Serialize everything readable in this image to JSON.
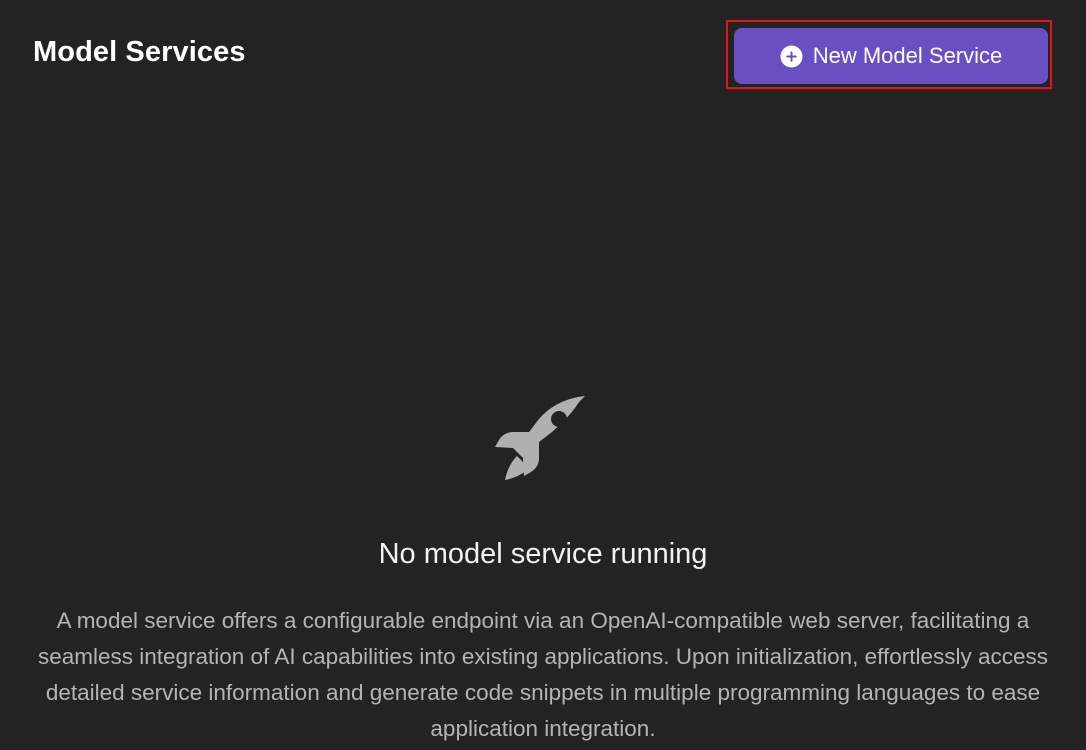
{
  "header": {
    "title": "Model Services",
    "new_button_label": "New Model Service",
    "new_button_icon": "plus-circle-icon"
  },
  "empty_state": {
    "icon": "rocket-icon",
    "title": "No model service running",
    "description": "A model service offers a configurable endpoint via an OpenAI-compatible web server, facilitating a seamless integration of AI capabilities into existing applications. Upon initialization, effortlessly access detailed service information and generate code snippets in multiple programming languages to ease application integration."
  },
  "colors": {
    "background": "#232323",
    "primary_button": "#6a4fc2",
    "highlight_border": "#e0141b",
    "icon_gray": "#b0b0b0",
    "description_text": "#b4b4b4"
  }
}
